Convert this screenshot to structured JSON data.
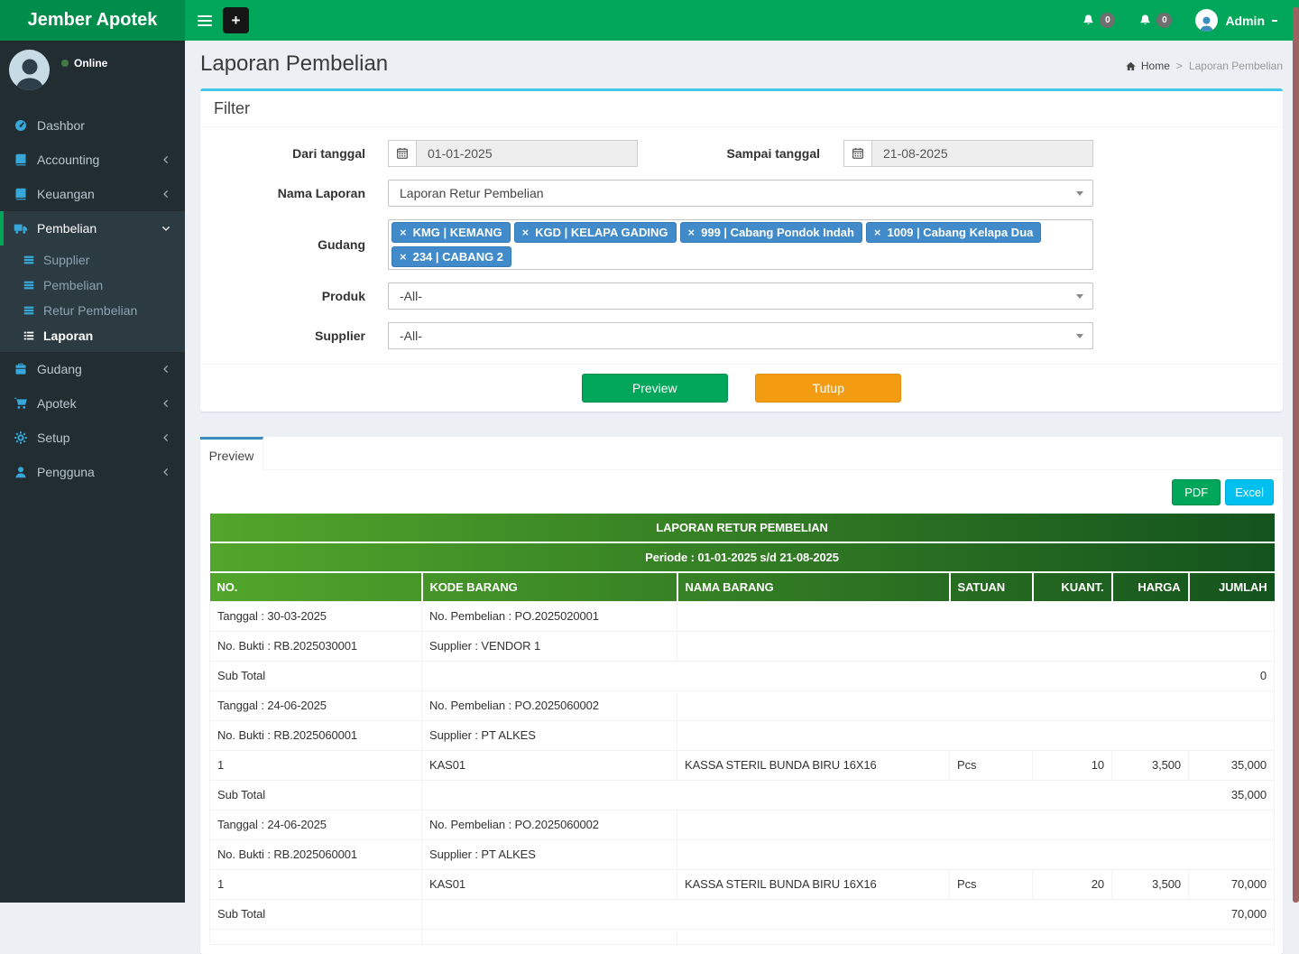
{
  "navbar": {
    "brand": "Jember Apotek",
    "plus_label": "+",
    "badges": [
      "0",
      "0"
    ],
    "user_label": "Admin"
  },
  "sidebar": {
    "status": "Online",
    "items": [
      {
        "label": "Dashbor",
        "icon": "dashboard"
      },
      {
        "label": "Accounting",
        "icon": "book",
        "chevron": "left"
      },
      {
        "label": "Keuangan",
        "icon": "book",
        "chevron": "left"
      },
      {
        "label": "Pembelian",
        "icon": "truck",
        "chevron": "down",
        "active": true,
        "children": [
          {
            "label": "Supplier",
            "icon": "table"
          },
          {
            "label": "Pembelian",
            "icon": "table"
          },
          {
            "label": "Retur Pembelian",
            "icon": "table"
          },
          {
            "label": "Laporan",
            "icon": "list",
            "active": true
          }
        ]
      },
      {
        "label": "Gudang",
        "icon": "briefcase",
        "chevron": "left"
      },
      {
        "label": "Apotek",
        "icon": "cart",
        "chevron": "left"
      },
      {
        "label": "Setup",
        "icon": "gear",
        "chevron": "left"
      },
      {
        "label": "Pengguna",
        "icon": "user",
        "chevron": "left"
      }
    ]
  },
  "page": {
    "title": "Laporan Pembelian",
    "breadcrumb_home": "Home",
    "breadcrumb_separator": ">",
    "breadcrumb_current": "Laporan Pembelian"
  },
  "filter": {
    "header": "Filter",
    "dari_label": "Dari tanggal",
    "dari_value": "01-01-2025",
    "sampai_label": "Sampai tanggal",
    "sampai_value": "21-08-2025",
    "nama_label": "Nama Laporan",
    "nama_value": "Laporan Retur Pembelian",
    "gudang_label": "Gudang",
    "gudang_tags": [
      "KMG | KEMANG",
      "KGD | KELAPA GADING",
      "999 | Cabang Pondok Indah",
      "1009 | Cabang Kelapa Dua",
      "234 | CABANG 2"
    ],
    "produk_label": "Produk",
    "produk_value": "-All-",
    "supplier_label": "Supplier",
    "supplier_value": "-All-",
    "preview_button": "Preview",
    "tutup_button": "Tutup"
  },
  "preview_panel": {
    "tab": "Preview",
    "pdf_button": "PDF",
    "excel_button": "Excel"
  },
  "report": {
    "title": "LAPORAN RETUR PEMBELIAN",
    "periode": "Periode : 01-01-2025 s/d 21-08-2025",
    "columns": [
      "NO.",
      "KODE BARANG",
      "NAMA BARANG",
      "SATUAN",
      "KUANT.",
      "HARGA",
      "JUMLAH"
    ],
    "rows": [
      {
        "type": "group",
        "c1": "Tanggal : 30-03-2025",
        "c2": "No. Pembelian : PO.2025020001"
      },
      {
        "type": "group",
        "c1": "No. Bukti : RB.2025030001",
        "c2": "Supplier : VENDOR 1"
      },
      {
        "type": "subtotal",
        "label": "Sub Total",
        "value": "0"
      },
      {
        "type": "group",
        "c1": "Tanggal : 24-06-2025",
        "c2": "No. Pembelian : PO.2025060002"
      },
      {
        "type": "group",
        "c1": "No. Bukti : RB.2025060001",
        "c2": "Supplier : PT ALKES"
      },
      {
        "type": "item",
        "no": "1",
        "kode": "KAS01",
        "nama": "KASSA STERIL BUNDA BIRU 16X16",
        "satuan": "Pcs",
        "kuant": "10",
        "harga": "3,500",
        "jumlah": "35,000"
      },
      {
        "type": "subtotal",
        "label": "Sub Total",
        "value": "35,000"
      },
      {
        "type": "group",
        "c1": "Tanggal : 24-06-2025",
        "c2": "No. Pembelian : PO.2025060002"
      },
      {
        "type": "group",
        "c1": "No. Bukti : RB.2025060001",
        "c2": "Supplier : PT ALKES"
      },
      {
        "type": "item",
        "no": "1",
        "kode": "KAS01",
        "nama": "KASSA STERIL BUNDA BIRU 16X16",
        "satuan": "Pcs",
        "kuant": "20",
        "harga": "3,500",
        "jumlah": "70,000"
      },
      {
        "type": "subtotal",
        "label": "Sub Total",
        "value": "70,000"
      },
      {
        "type": "group",
        "c1": "",
        "c2": ""
      }
    ]
  },
  "colors": {
    "navbar_green": "#00a65a",
    "brand_green": "#008d4c",
    "sidebar_dark": "#222d32",
    "submenu_dark": "#2c3b41",
    "icon_blue": "#37a6d8",
    "filter_border": "#45c7e9",
    "tab_border": "#3c8dbc",
    "tag_blue": "#428bca",
    "orange": "#f39c12",
    "aqua": "#00c0ef",
    "header_gradient_left": "#52a62b",
    "header_gradient_right": "#14531d",
    "scrollbar": "#9b6361"
  }
}
